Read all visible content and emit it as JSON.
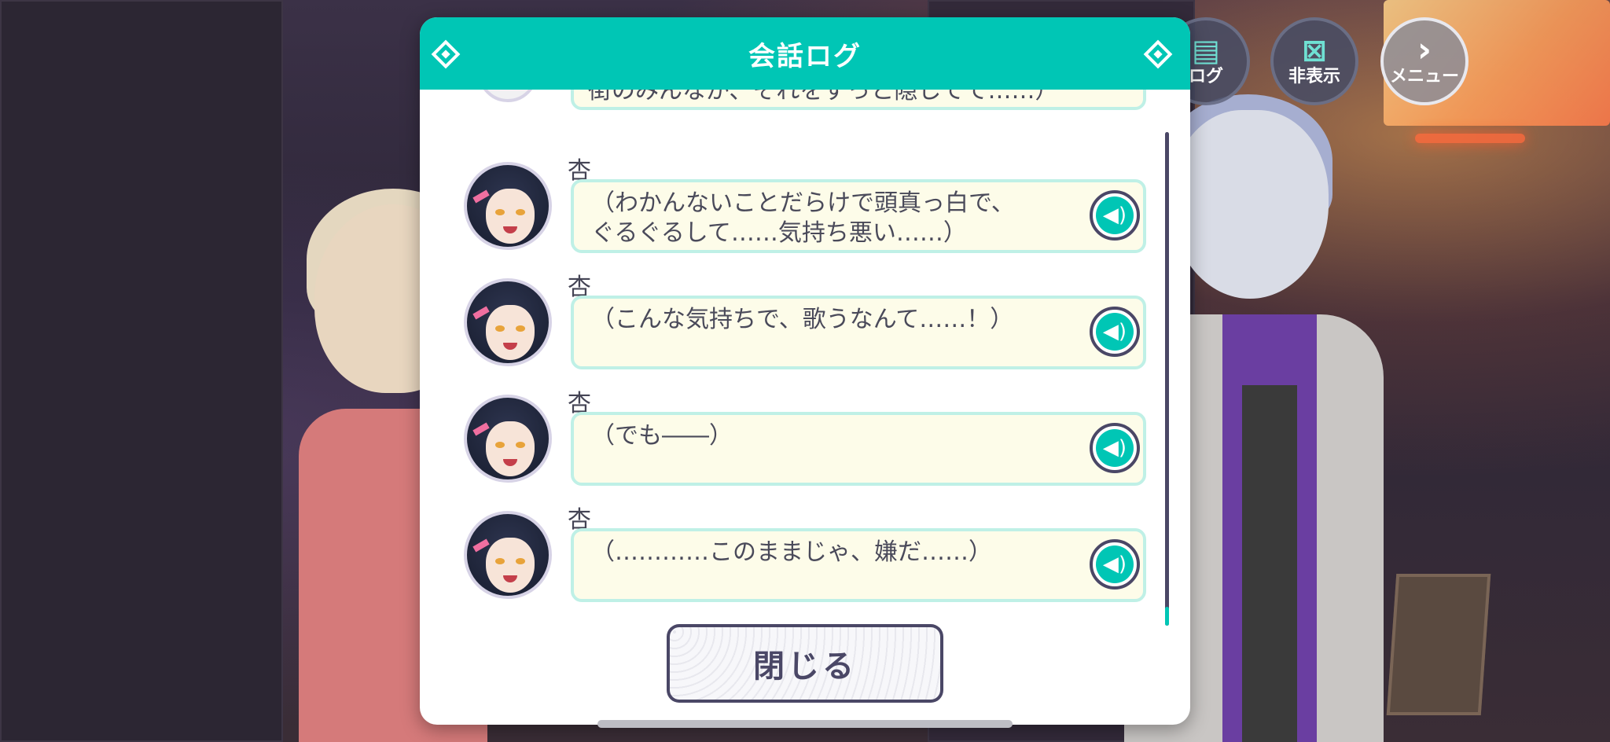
{
  "dialog": {
    "title": "会話ログ",
    "close_label": "閉じる",
    "partial_entry_text": "街のみんなが、それをずっと隠してて……）",
    "entries": [
      {
        "speaker": "杏",
        "text": "（わかんないことだらけで頭真っ白で、\nぐるぐるして……気持ち悪い……）"
      },
      {
        "speaker": "杏",
        "text": "（こんな気持ちで、歌うなんて……！）"
      },
      {
        "speaker": "杏",
        "text": "（でも――）"
      },
      {
        "speaker": "杏",
        "text": "（…………このままじゃ、嫌だ……）"
      }
    ]
  },
  "hud": {
    "log_label": "ログ",
    "hide_label": "非表示",
    "menu_label": "メニュー"
  },
  "colors": {
    "accent": "#00c6b5",
    "bubble_bg": "#fdfce9",
    "bubble_border": "#bff0e6",
    "dark": "#4a4766"
  },
  "icons": {
    "log": "chat-bubble-icon",
    "hide": "hide-x-icon",
    "menu": "chevron-right-icon",
    "voice": "speaker-icon"
  }
}
